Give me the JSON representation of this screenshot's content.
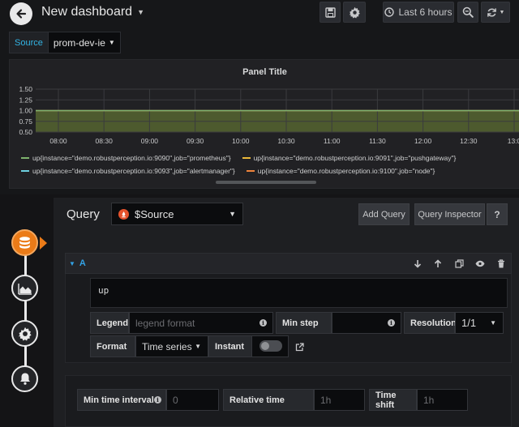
{
  "topbar": {
    "title": "New dashboard",
    "time_range": "Last 6 hours"
  },
  "variables": {
    "source_label": "Source",
    "source_value": "prom-dev-ie"
  },
  "panel": {
    "title": "Panel Title",
    "y_ticks": [
      "1.50",
      "1.25",
      "1.00",
      "0.75",
      "0.50"
    ],
    "x_ticks": [
      "08:00",
      "08:30",
      "09:00",
      "09:30",
      "10:00",
      "10:30",
      "11:00",
      "11:30",
      "12:00",
      "12:30",
      "13:0"
    ],
    "series_value": 1.0,
    "y_range": [
      0.5,
      1.5
    ],
    "fill_color": "#4d5a2e",
    "legend": [
      {
        "label": "up{instance=\"demo.robustperception.io:9090\",job=\"prometheus\"}",
        "color": "#7eb26d"
      },
      {
        "label": "up{instance=\"demo.robustperception.io:9091\",job=\"pushgateway\"}",
        "color": "#eab839"
      },
      {
        "label": "up{instance=\"demo.robustperception.io:9093\",job=\"alertmanager\"}",
        "color": "#6ed0e0"
      },
      {
        "label": "up{instance=\"demo.robustperception.io:9100\",job=\"node\"}",
        "color": "#ef843c"
      }
    ]
  },
  "editor": {
    "query_label": "Query",
    "datasource": "$Source",
    "add_query": "Add Query",
    "query_inspector": "Query Inspector",
    "help": "?",
    "query_letter": "A",
    "expression": "up",
    "legend_label": "Legend",
    "legend_placeholder": "legend format",
    "min_step_label": "Min step",
    "resolution_label": "Resolution",
    "resolution_value": "1/1",
    "format_label": "Format",
    "format_value": "Time series",
    "instant_label": "Instant",
    "min_interval_label": "Min time interval",
    "min_interval_placeholder": "0",
    "relative_time_label": "Relative time",
    "relative_time_placeholder": "1h",
    "time_shift_label": "Time shift",
    "time_shift_placeholder": "1h"
  },
  "colors": {
    "accent_orange": "#eb7b18",
    "query_letter": "#33a2e5",
    "source_label": "#33b5e5"
  }
}
